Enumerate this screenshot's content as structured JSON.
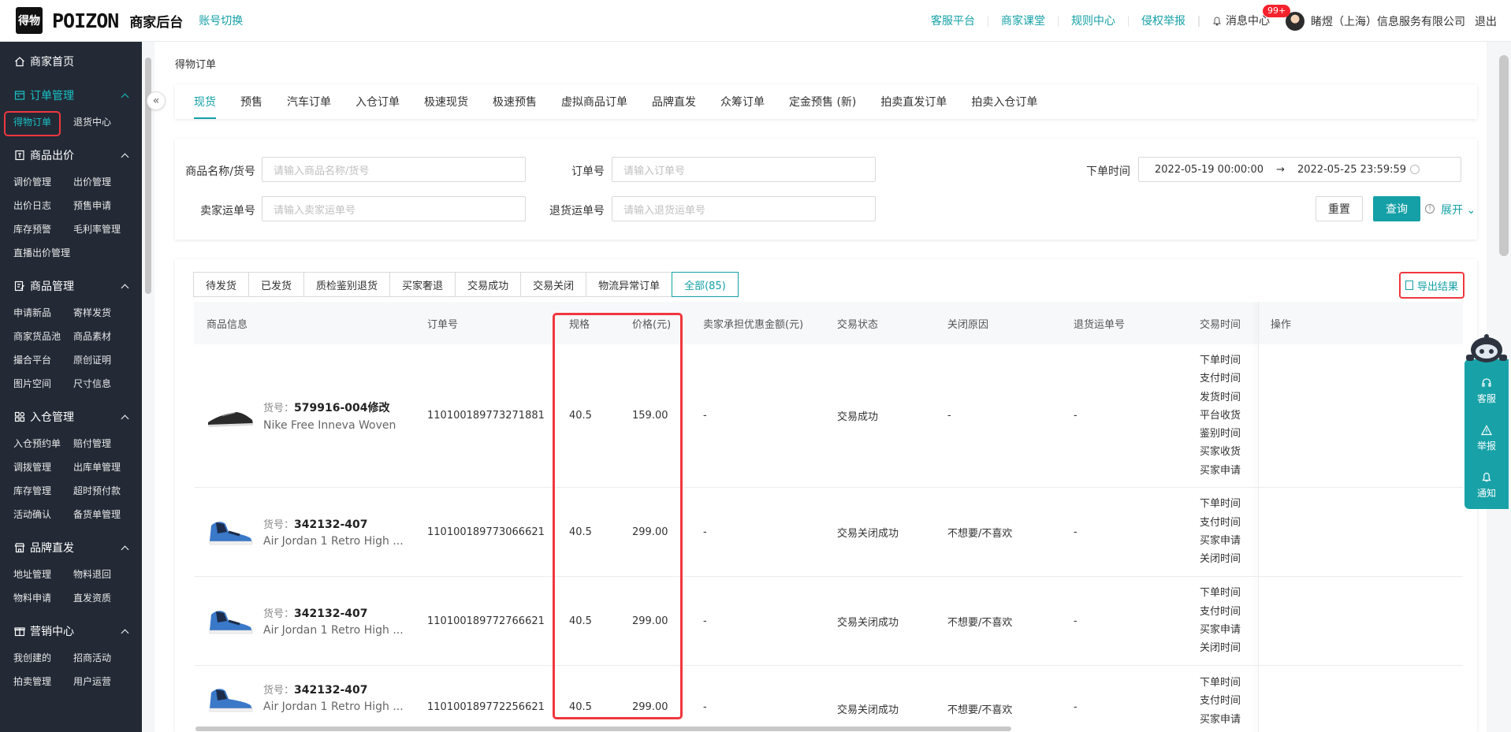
{
  "header": {
    "logo_mark": "得物",
    "logo_word": "POIZON",
    "app_title": "商家后台",
    "switch_account": "账号切换",
    "links": [
      "客服平台",
      "商家课堂",
      "规则中心",
      "侵权举报"
    ],
    "messages_label": "消息中心",
    "messages_badge": "99+",
    "company": "睹煜（上海）信息服务有限公司",
    "logout": "退出"
  },
  "sidebar": {
    "home": "商家首页",
    "groups": [
      {
        "title": "订单管理",
        "active": true,
        "items": [
          "得物订单",
          "退货中心"
        ]
      },
      {
        "title": "商品出价",
        "items": [
          "调价管理",
          "出价管理",
          "出价日志",
          "预售申请",
          "库存预警",
          "毛利率管理",
          "直播出价管理"
        ]
      },
      {
        "title": "商品管理",
        "items": [
          "申请新品",
          "寄样发货",
          "商家货品池",
          "商品素材",
          "撮合平台",
          "原创证明",
          "图片空间",
          "尺寸信息"
        ]
      },
      {
        "title": "入仓管理",
        "items": [
          "入仓预约单",
          "赔付管理",
          "调拨管理",
          "出库单管理",
          "库存管理",
          "超时预付款",
          "活动确认",
          "备货单管理"
        ]
      },
      {
        "title": "品牌直发",
        "items": [
          "地址管理",
          "物料退回",
          "物料申请",
          "直发资质"
        ]
      },
      {
        "title": "营销中心",
        "items": [
          "我创建的",
          "招商活动",
          "拍卖管理",
          "用户运营"
        ]
      }
    ]
  },
  "breadcrumb": "得物订单",
  "order_tabs": [
    "现货",
    "预售",
    "汽车订单",
    "入仓订单",
    "极速现货",
    "极速预售",
    "虚拟商品订单",
    "品牌直发",
    "众筹订单",
    "定金预售 (新)",
    "拍卖直发订单",
    "拍卖入仓订单"
  ],
  "filters": {
    "product_label": "商品名称/货号",
    "product_placeholder": "请输入商品名称/货号",
    "order_label": "订单号",
    "order_placeholder": "请输入订单号",
    "time_label": "下单时间",
    "time_start": "2022-05-19 00:00:00",
    "time_arrow": "→",
    "time_end": "2022-05-25 23:59:59",
    "seller_waybill_label": "卖家运单号",
    "seller_waybill_placeholder": "请输入卖家运单号",
    "return_waybill_label": "退货运单号",
    "return_waybill_placeholder": "请输入退货运单号",
    "reset": "重置",
    "query": "查询",
    "expand": "展开"
  },
  "status_tabs": [
    "待发货",
    "已发货",
    "质检鉴别退货",
    "买家奢退",
    "交易成功",
    "交易关闭",
    "物流异常订单",
    "全部(85)"
  ],
  "export_label": "导出结果",
  "table": {
    "columns": [
      "商品信息",
      "订单号",
      "规格",
      "价格(元)",
      "卖家承担优惠金额(元)",
      "交易状态",
      "关闭原因",
      "退货运单号",
      "交易时间",
      "操作"
    ],
    "sku_prefix": "货号：",
    "rows": [
      {
        "sku": "579916-004修改",
        "name": "Nike Free Inneva Woven",
        "order_no": "110100189773271881",
        "size": "40.5",
        "price": "159.00",
        "discount": "-",
        "status": "交易成功",
        "close_reason": "-",
        "return_waybill": "-",
        "times": [
          "下单时间",
          "支付时间",
          "发货时间",
          "平台收货",
          "鉴别时间",
          "买家收货",
          "买家申请"
        ]
      },
      {
        "sku": "342132-407",
        "name": "Air Jordan 1 Retro High ...",
        "order_no": "110100189773066621",
        "size": "40.5",
        "price": "299.00",
        "discount": "-",
        "status": "交易关闭成功",
        "close_reason": "不想要/不喜欢",
        "return_waybill": "-",
        "times": [
          "下单时间",
          "支付时间",
          "买家申请",
          "关闭时间"
        ]
      },
      {
        "sku": "342132-407",
        "name": "Air Jordan 1 Retro High ...",
        "order_no": "110100189772766621",
        "size": "40.5",
        "price": "299.00",
        "discount": "-",
        "status": "交易关闭成功",
        "close_reason": "不想要/不喜欢",
        "return_waybill": "-",
        "times": [
          "下单时间",
          "支付时间",
          "买家申请",
          "关闭时间"
        ]
      },
      {
        "sku": "342132-407",
        "name": "Air Jordan 1 Retro High ...",
        "order_no": "110100189772256621",
        "size": "40.5",
        "price": "299.00",
        "discount": "-",
        "status": "交易关闭成功",
        "close_reason": "不想要/不喜欢",
        "return_waybill": "-",
        "times": [
          "下单时间",
          "支付时间",
          "买家申请"
        ]
      }
    ]
  },
  "float_bar": [
    "客服",
    "举报",
    "通知"
  ],
  "colors": {
    "accent": "#14a0a6",
    "sidebar_bg": "#232a36",
    "highlight": "#f0373d"
  }
}
